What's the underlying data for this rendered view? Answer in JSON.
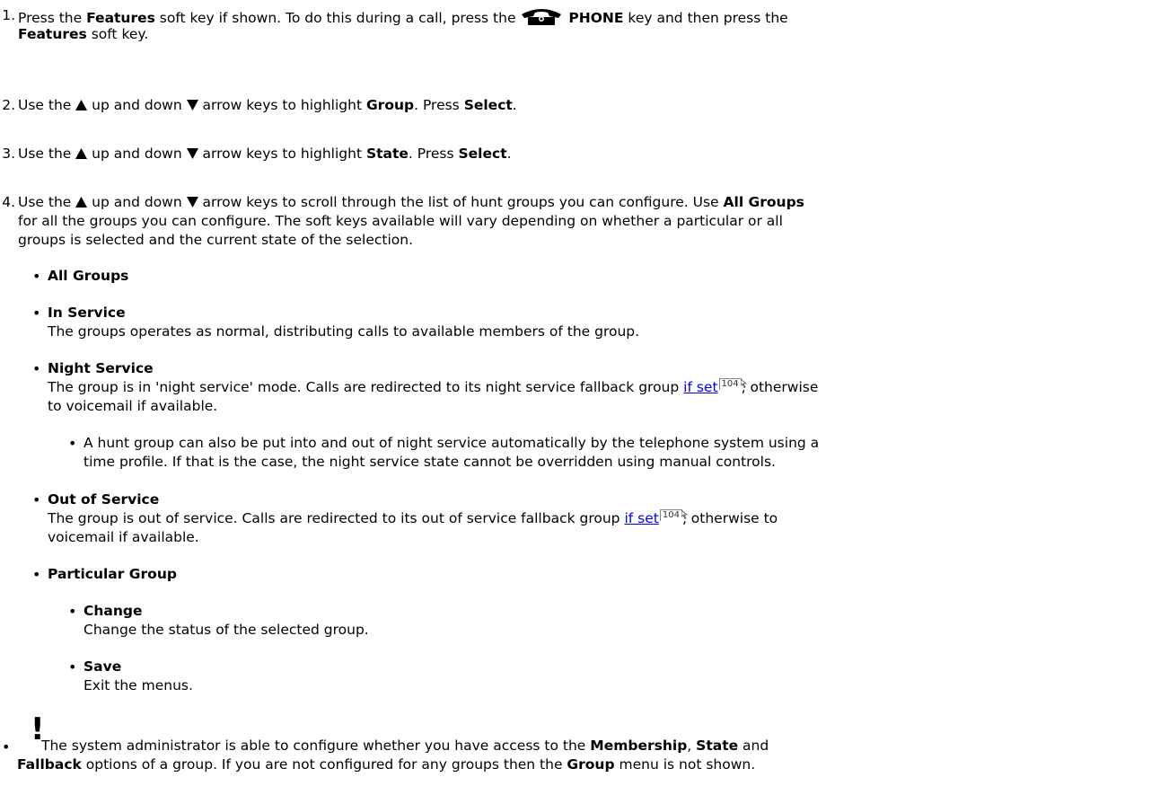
{
  "steps": {
    "s1": {
      "num": "1.",
      "a": "Press the ",
      "b1": "Features",
      "c": " soft key if shown. To do this during a call, press the ",
      "phone_key": "PHONE",
      "d": " key and then press the",
      "e_bold": "Features",
      "f": " soft key."
    },
    "s2": {
      "num": "2.",
      "a": "Use the ",
      "b": " up and down ",
      "c": " arrow keys to highlight ",
      "d_bold": "Group",
      "e": ". Press ",
      "f_bold": "Select",
      "g": "."
    },
    "s3": {
      "num": "3.",
      "a": "Use the ",
      "b": " up and down ",
      "c": " arrow keys to highlight ",
      "d_bold": "State",
      "e": ". Press ",
      "f_bold": "Select",
      "g": "."
    },
    "s4": {
      "num": "4.",
      "a": "Use the ",
      "b": " up and down ",
      "c": " arrow keys to scroll through the list of hunt groups you can configure. Use ",
      "d_bold": "All Groups",
      "line2": "for all the groups you can configure. The soft keys available will vary depending on whether a particular or all",
      "line3": "groups is selected and the current state of the selection."
    }
  },
  "items": {
    "all_groups": "All Groups",
    "in_service": "In Service",
    "in_service_desc": "The groups operates as normal, distributing calls to available members of the group.",
    "night_service": "Night Service",
    "night_desc_a": "The group is in 'night service' mode. Calls are redirected to its night service fallback group ",
    "night_link": "if set",
    "night_ref": "104",
    "night_desc_b": ", otherwise",
    "night_desc_line2": "to voicemail if available.",
    "night_sub_line1": "A hunt group can also be put into and out of night service automatically by the telephone system using a",
    "night_sub_line2": "time profile. If that is the case, the night service state cannot be overridden using manual controls.",
    "out_of_service": "Out of Service",
    "oos_desc_a": "The group is out of service. Calls are redirected to its out of service fallback group ",
    "oos_link": "if set",
    "oos_ref": "104",
    "oos_desc_b": ", otherwise to",
    "oos_desc_line2": "voicemail if available.",
    "particular_group": "Particular Group",
    "change": "Change",
    "change_desc": "Change the status of the selected group.",
    "save": "Save",
    "save_desc": "Exit the menus."
  },
  "note": {
    "mark": "!",
    "a": " The system administrator is able to configure whether you have access to the ",
    "membership": "Membership",
    "comma": ", ",
    "state": "State",
    "and": " and",
    "fallback": "Fallback",
    "b": " options of a group. If you are not configured for any groups then the ",
    "group": "Group",
    "c": " menu is not shown."
  },
  "icons": {
    "phone": "phone-key-icon",
    "up": "up-arrow-icon",
    "down": "down-arrow-icon",
    "bullet": "bullet-dot"
  }
}
